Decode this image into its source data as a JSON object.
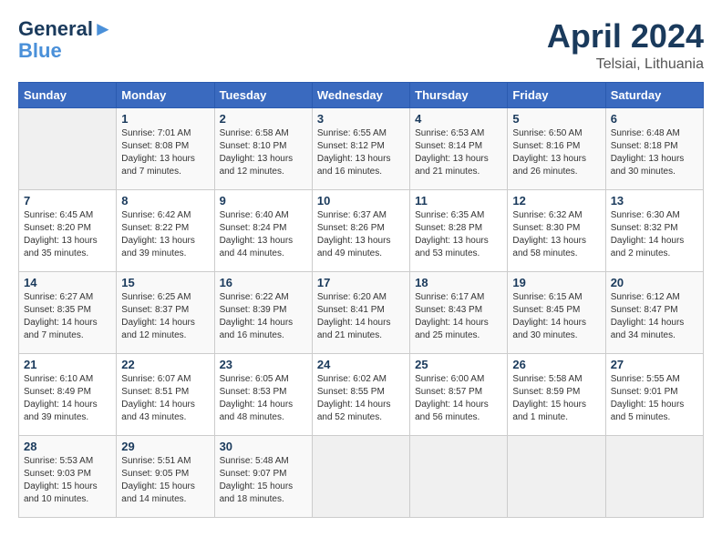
{
  "header": {
    "logo_line1": "General",
    "logo_line2": "Blue",
    "month_year": "April 2024",
    "location": "Telsiai, Lithuania"
  },
  "weekdays": [
    "Sunday",
    "Monday",
    "Tuesday",
    "Wednesday",
    "Thursday",
    "Friday",
    "Saturday"
  ],
  "weeks": [
    [
      {
        "day": "",
        "content": ""
      },
      {
        "day": "1",
        "content": "Sunrise: 7:01 AM\nSunset: 8:08 PM\nDaylight: 13 hours\nand 7 minutes."
      },
      {
        "day": "2",
        "content": "Sunrise: 6:58 AM\nSunset: 8:10 PM\nDaylight: 13 hours\nand 12 minutes."
      },
      {
        "day": "3",
        "content": "Sunrise: 6:55 AM\nSunset: 8:12 PM\nDaylight: 13 hours\nand 16 minutes."
      },
      {
        "day": "4",
        "content": "Sunrise: 6:53 AM\nSunset: 8:14 PM\nDaylight: 13 hours\nand 21 minutes."
      },
      {
        "day": "5",
        "content": "Sunrise: 6:50 AM\nSunset: 8:16 PM\nDaylight: 13 hours\nand 26 minutes."
      },
      {
        "day": "6",
        "content": "Sunrise: 6:48 AM\nSunset: 8:18 PM\nDaylight: 13 hours\nand 30 minutes."
      }
    ],
    [
      {
        "day": "7",
        "content": "Sunrise: 6:45 AM\nSunset: 8:20 PM\nDaylight: 13 hours\nand 35 minutes."
      },
      {
        "day": "8",
        "content": "Sunrise: 6:42 AM\nSunset: 8:22 PM\nDaylight: 13 hours\nand 39 minutes."
      },
      {
        "day": "9",
        "content": "Sunrise: 6:40 AM\nSunset: 8:24 PM\nDaylight: 13 hours\nand 44 minutes."
      },
      {
        "day": "10",
        "content": "Sunrise: 6:37 AM\nSunset: 8:26 PM\nDaylight: 13 hours\nand 49 minutes."
      },
      {
        "day": "11",
        "content": "Sunrise: 6:35 AM\nSunset: 8:28 PM\nDaylight: 13 hours\nand 53 minutes."
      },
      {
        "day": "12",
        "content": "Sunrise: 6:32 AM\nSunset: 8:30 PM\nDaylight: 13 hours\nand 58 minutes."
      },
      {
        "day": "13",
        "content": "Sunrise: 6:30 AM\nSunset: 8:32 PM\nDaylight: 14 hours\nand 2 minutes."
      }
    ],
    [
      {
        "day": "14",
        "content": "Sunrise: 6:27 AM\nSunset: 8:35 PM\nDaylight: 14 hours\nand 7 minutes."
      },
      {
        "day": "15",
        "content": "Sunrise: 6:25 AM\nSunset: 8:37 PM\nDaylight: 14 hours\nand 12 minutes."
      },
      {
        "day": "16",
        "content": "Sunrise: 6:22 AM\nSunset: 8:39 PM\nDaylight: 14 hours\nand 16 minutes."
      },
      {
        "day": "17",
        "content": "Sunrise: 6:20 AM\nSunset: 8:41 PM\nDaylight: 14 hours\nand 21 minutes."
      },
      {
        "day": "18",
        "content": "Sunrise: 6:17 AM\nSunset: 8:43 PM\nDaylight: 14 hours\nand 25 minutes."
      },
      {
        "day": "19",
        "content": "Sunrise: 6:15 AM\nSunset: 8:45 PM\nDaylight: 14 hours\nand 30 minutes."
      },
      {
        "day": "20",
        "content": "Sunrise: 6:12 AM\nSunset: 8:47 PM\nDaylight: 14 hours\nand 34 minutes."
      }
    ],
    [
      {
        "day": "21",
        "content": "Sunrise: 6:10 AM\nSunset: 8:49 PM\nDaylight: 14 hours\nand 39 minutes."
      },
      {
        "day": "22",
        "content": "Sunrise: 6:07 AM\nSunset: 8:51 PM\nDaylight: 14 hours\nand 43 minutes."
      },
      {
        "day": "23",
        "content": "Sunrise: 6:05 AM\nSunset: 8:53 PM\nDaylight: 14 hours\nand 48 minutes."
      },
      {
        "day": "24",
        "content": "Sunrise: 6:02 AM\nSunset: 8:55 PM\nDaylight: 14 hours\nand 52 minutes."
      },
      {
        "day": "25",
        "content": "Sunrise: 6:00 AM\nSunset: 8:57 PM\nDaylight: 14 hours\nand 56 minutes."
      },
      {
        "day": "26",
        "content": "Sunrise: 5:58 AM\nSunset: 8:59 PM\nDaylight: 15 hours\nand 1 minute."
      },
      {
        "day": "27",
        "content": "Sunrise: 5:55 AM\nSunset: 9:01 PM\nDaylight: 15 hours\nand 5 minutes."
      }
    ],
    [
      {
        "day": "28",
        "content": "Sunrise: 5:53 AM\nSunset: 9:03 PM\nDaylight: 15 hours\nand 10 minutes."
      },
      {
        "day": "29",
        "content": "Sunrise: 5:51 AM\nSunset: 9:05 PM\nDaylight: 15 hours\nand 14 minutes."
      },
      {
        "day": "30",
        "content": "Sunrise: 5:48 AM\nSunset: 9:07 PM\nDaylight: 15 hours\nand 18 minutes."
      },
      {
        "day": "",
        "content": ""
      },
      {
        "day": "",
        "content": ""
      },
      {
        "day": "",
        "content": ""
      },
      {
        "day": "",
        "content": ""
      }
    ]
  ]
}
